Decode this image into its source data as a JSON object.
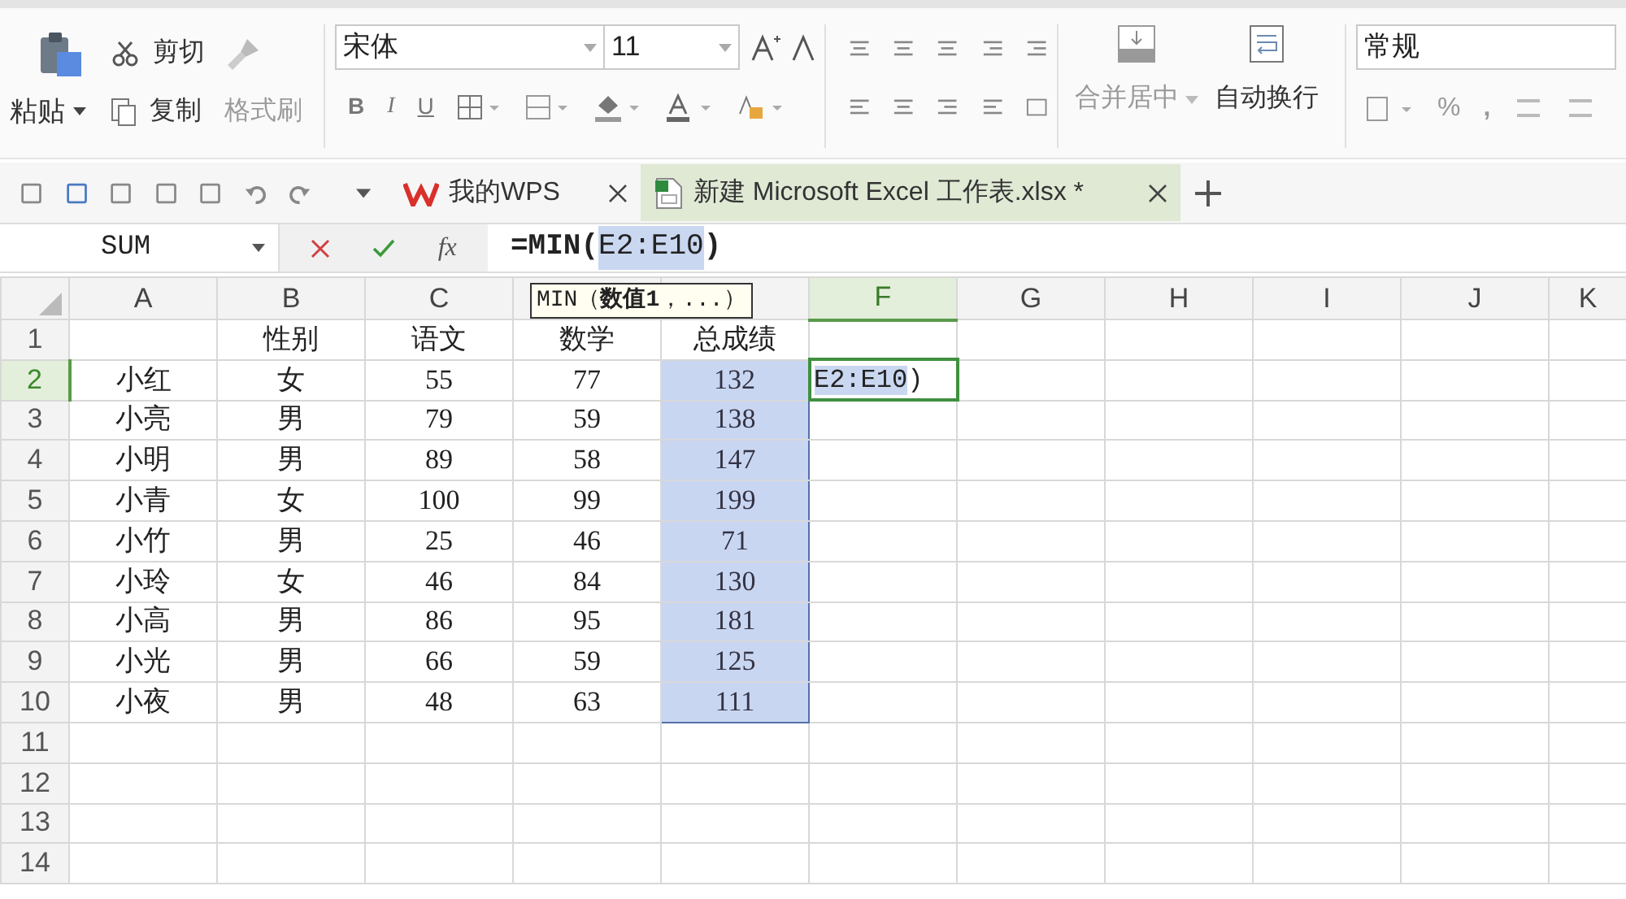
{
  "ribbon": {
    "clipboard": {
      "paste": "粘贴",
      "cut": "剪切",
      "copy": "复制",
      "format_painter": "格式刷"
    },
    "font": {
      "name": "宋体",
      "size": "11",
      "bold": "B",
      "italic": "I",
      "underline": "U"
    },
    "merge": "合并居中",
    "wrap": "自动换行",
    "number_format": "常规",
    "percent": "%",
    "comma": ","
  },
  "doc_tabs": [
    {
      "label": "我的WPS",
      "kind": "home",
      "selected": false
    },
    {
      "label": "新建 Microsoft Excel 工作表.xlsx *",
      "kind": "sheet",
      "selected": true
    }
  ],
  "formula_bar": {
    "name_box": "SUM",
    "fx": "fx",
    "before": "=MIN(",
    "reference": "E2:E10",
    "after": ")"
  },
  "tooltip": "MIN（**数值1**，...）",
  "sheet": {
    "columns": [
      {
        "label": "A",
        "selected": false
      },
      {
        "label": "B",
        "selected": false
      },
      {
        "label": "C",
        "selected": false
      },
      {
        "selected": false
      },
      {
        "selected": false
      },
      {
        "label": "F",
        "selected": true
      },
      {
        "label": "G",
        "selected": false
      },
      {
        "label": "H",
        "selected": false
      },
      {
        "label": "I",
        "selected": false
      },
      {
        "label": "J",
        "selected": false
      },
      {
        "label": "K",
        "selected": false
      }
    ],
    "rows": [
      {
        "label": "1",
        "selected": false,
        "cells": [
          {
            "text": "",
            "selected": false
          },
          {
            "text": "性别",
            "selected": false
          },
          {
            "text": "语文",
            "selected": false
          },
          {
            "text": "数学",
            "selected": false
          },
          {
            "text": "总成绩",
            "selected": false
          }
        ]
      },
      {
        "label": "2",
        "selected": true,
        "cells": [
          {
            "text": "小红",
            "selected": false
          },
          {
            "text": "女",
            "selected": false
          },
          {
            "text": "55",
            "selected": false
          },
          {
            "text": "77",
            "selected": false
          },
          {
            "text": "132",
            "selected": true
          },
          {
            "kind": "edit",
            "reference": "E2:E10",
            "after": ")",
            "selected": false
          }
        ]
      },
      {
        "label": "3",
        "selected": false,
        "cells": [
          {
            "text": "小亮",
            "selected": false
          },
          {
            "text": "男",
            "selected": false
          },
          {
            "text": "79",
            "selected": false
          },
          {
            "text": "59",
            "selected": false
          },
          {
            "text": "138",
            "selected": true
          }
        ]
      },
      {
        "label": "4",
        "selected": false,
        "cells": [
          {
            "text": "小明",
            "selected": false
          },
          {
            "text": "男",
            "selected": false
          },
          {
            "text": "89",
            "selected": false
          },
          {
            "text": "58",
            "selected": false
          },
          {
            "text": "147",
            "selected": true
          }
        ]
      },
      {
        "label": "5",
        "selected": false,
        "cells": [
          {
            "text": "小青",
            "selected": false
          },
          {
            "text": "女",
            "selected": false
          },
          {
            "text": "100",
            "selected": false
          },
          {
            "text": "99",
            "selected": false
          },
          {
            "text": "199",
            "selected": true
          }
        ]
      },
      {
        "label": "6",
        "selected": false,
        "cells": [
          {
            "text": "小竹",
            "selected": false
          },
          {
            "text": "男",
            "selected": false
          },
          {
            "text": "25",
            "selected": false
          },
          {
            "text": "46",
            "selected": false
          },
          {
            "text": "71",
            "selected": true
          }
        ]
      },
      {
        "label": "7",
        "selected": false,
        "cells": [
          {
            "text": "小玲",
            "selected": false
          },
          {
            "text": "女",
            "selected": false
          },
          {
            "text": "46",
            "selected": false
          },
          {
            "text": "84",
            "selected": false
          },
          {
            "text": "130",
            "selected": true
          }
        ]
      },
      {
        "label": "8",
        "selected": false,
        "cells": [
          {
            "text": "小高",
            "selected": false
          },
          {
            "text": "男",
            "selected": false
          },
          {
            "text": "86",
            "selected": false
          },
          {
            "text": "95",
            "selected": false
          },
          {
            "text": "181",
            "selected": true
          }
        ]
      },
      {
        "label": "9",
        "selected": false,
        "cells": [
          {
            "text": "小光",
            "selected": false
          },
          {
            "text": "男",
            "selected": false
          },
          {
            "text": "66",
            "selected": false
          },
          {
            "text": "59",
            "selected": false
          },
          {
            "text": "125",
            "selected": true
          }
        ]
      },
      {
        "label": "10",
        "selected": false,
        "cells": [
          {
            "text": "小夜",
            "selected": false
          },
          {
            "text": "男",
            "selected": false
          },
          {
            "text": "48",
            "selected": false
          },
          {
            "text": "63",
            "selected": false
          },
          {
            "text": "111",
            "selected": true
          }
        ]
      },
      {
        "label": "11",
        "selected": false,
        "cells": []
      },
      {
        "label": "12",
        "selected": false,
        "cells": []
      },
      {
        "label": "13",
        "selected": false,
        "cells": []
      },
      {
        "label": "14",
        "selected": false,
        "cells": []
      }
    ]
  }
}
